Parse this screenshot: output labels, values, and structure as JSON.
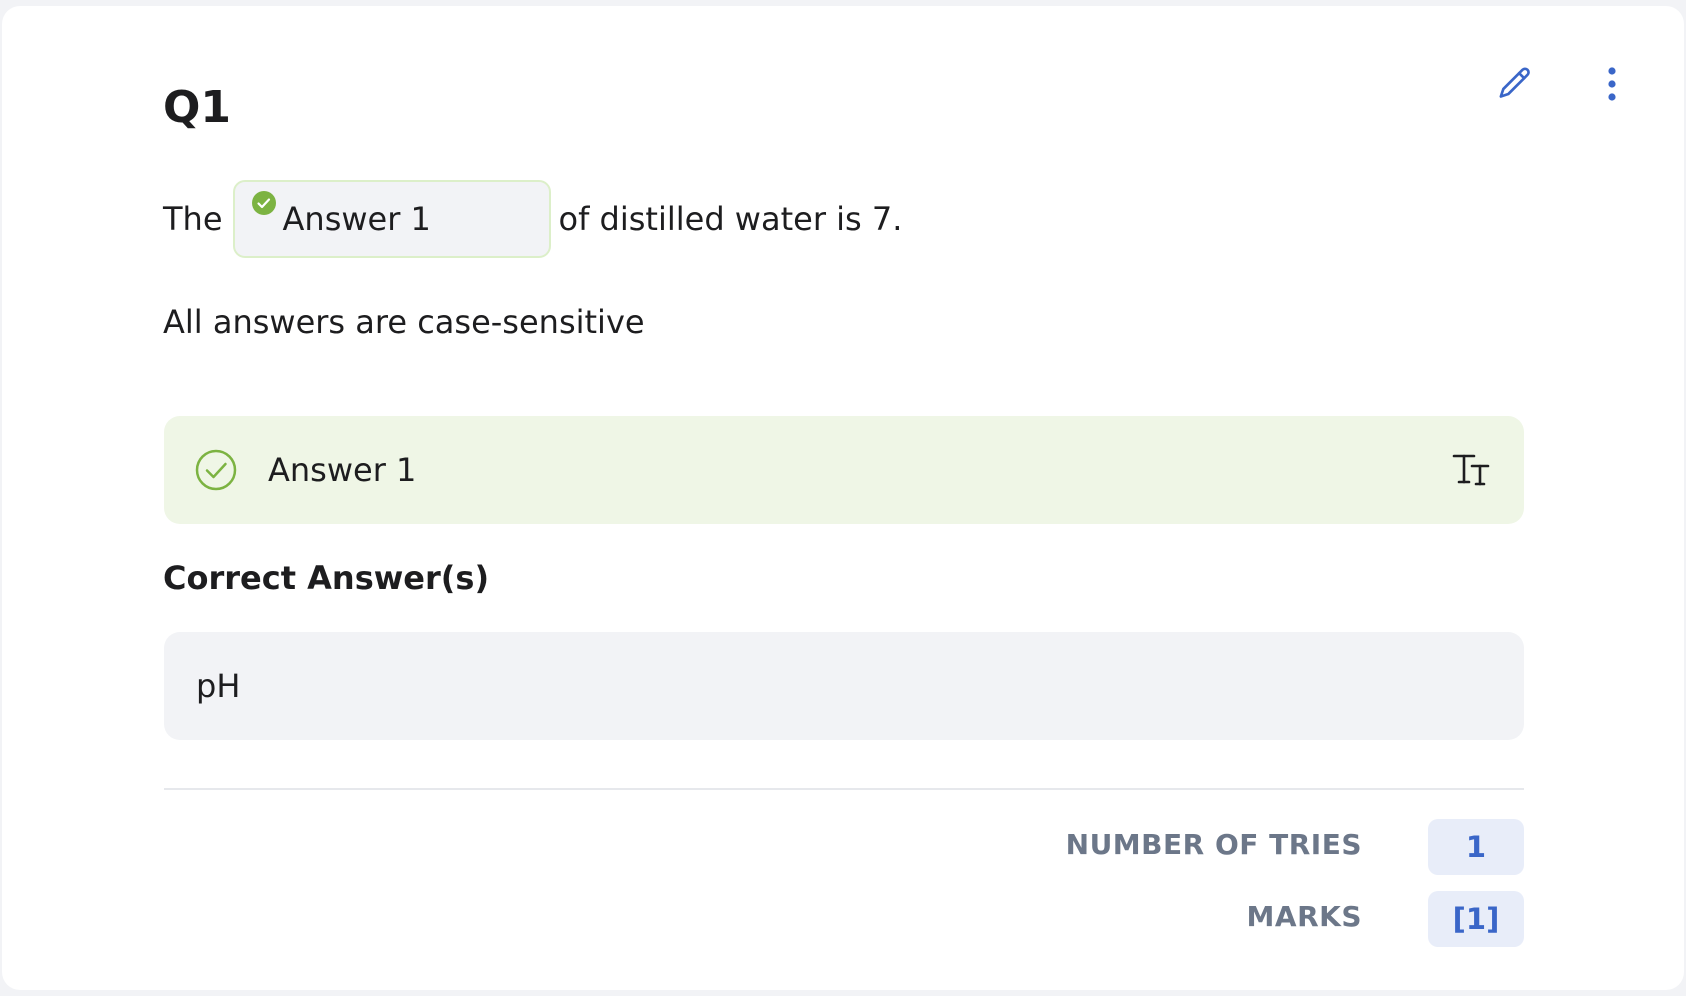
{
  "question": {
    "title": "Q1",
    "text_before": "The",
    "blank_label": "Answer 1",
    "text_after": "of distilled water is 7.",
    "note": "All answers are case-sensitive"
  },
  "toolbar": {
    "edit_icon": "pencil-icon",
    "more_icon": "vertical-dots-icon"
  },
  "answer_option": {
    "label": "Answer 1",
    "status": "correct",
    "format_icon": "text-size-icon"
  },
  "correct_answers": {
    "heading": "Correct Answer(s)",
    "values": [
      "pH"
    ]
  },
  "meta": {
    "tries_label": "NUMBER OF TRIES",
    "tries_value": "1",
    "marks_label": "MARKS",
    "marks_value": "[1]"
  },
  "colors": {
    "accent_blue": "#3a66c8",
    "success_green": "#7cb342",
    "answer_bg": "#eff6e6",
    "muted_label": "#6c7789"
  }
}
